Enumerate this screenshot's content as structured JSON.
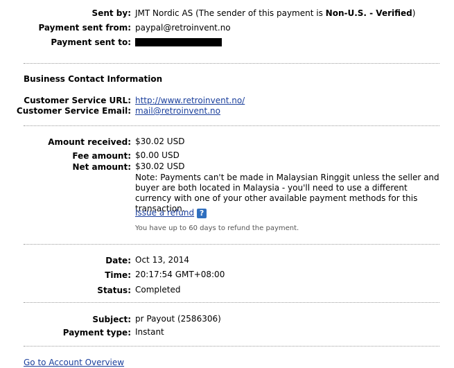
{
  "sender": {
    "sent_by_label": "Sent by:",
    "sent_by_value": "JMT Nordic AS (The sender of this payment is ",
    "sent_by_status": "Non-U.S. - Verified",
    "sent_by_close": ")",
    "sent_from_label": "Payment sent from:",
    "sent_from_value": "paypal@retroinvent.no",
    "sent_to_label": "Payment sent to:"
  },
  "business": {
    "section_title": "Business Contact Information",
    "url_label": "Customer Service URL:",
    "url_value": "http://www.retroinvent.no/",
    "email_label": "Customer Service Email:",
    "email_value": "mail@retroinvent.no"
  },
  "amounts": {
    "received_label": "Amount received:",
    "received_value": "$30.02 USD",
    "fee_label": "Fee amount:",
    "fee_value": "$0.00 USD",
    "net_label": "Net amount:",
    "net_value": "$30.02 USD",
    "note": "Note: Payments can't be made in Malaysian Ringgit unless the seller and buyer are both located in Malaysia - you'll need to use a different currency with one of your other available payment methods for this transaction.",
    "refund_link": "Issue a refund",
    "help_icon": "?",
    "refund_hint": "You have up to 60 days to refund the payment."
  },
  "timing": {
    "date_label": "Date:",
    "date_value": "Oct 13, 2014",
    "time_label": "Time:",
    "time_value": "20:17:54 GMT+08:00",
    "status_label": "Status:",
    "status_value": "Completed"
  },
  "details": {
    "subject_label": "Subject:",
    "subject_value": "pr Payout (2586306)",
    "type_label": "Payment type:",
    "type_value": "Instant"
  },
  "footer": {
    "overview_link": "Go to Account Overview"
  }
}
